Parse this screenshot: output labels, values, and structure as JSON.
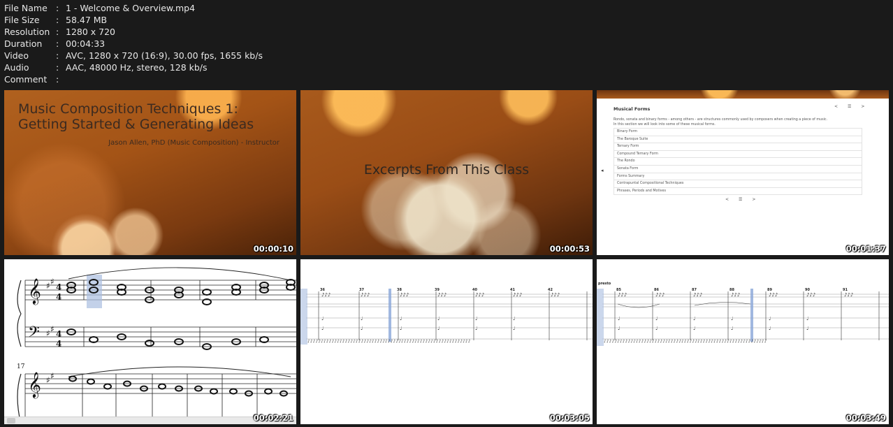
{
  "file_info": [
    {
      "label": "File Name",
      "value": "1 - Welcome & Overview.mp4"
    },
    {
      "label": "File Size",
      "value": "58.47 MB"
    },
    {
      "label": "Resolution",
      "value": "1280 x 720"
    },
    {
      "label": "Duration",
      "value": "00:04:33"
    },
    {
      "label": "Video",
      "value": "AVC, 1280 x 720 (16:9), 30.00 fps, 1655 kb/s"
    },
    {
      "label": "Audio",
      "value": "AAC, 48000 Hz, stereo, 128 kb/s"
    },
    {
      "label": "Comment",
      "value": ""
    }
  ],
  "thumbnails": [
    {
      "timestamp": "00:00:10",
      "title": "Music Composition Techniques 1:\nGetting Started & Generating Ideas",
      "subtitle": "Jason Allen, PhD (Music Composition) - Instructor"
    },
    {
      "timestamp": "00:00:53",
      "caption": "Excerpts From This Class"
    },
    {
      "timestamp": "00:01:37",
      "page_title": "Musical Forms",
      "nav": [
        "<",
        "☰",
        ">"
      ],
      "intro": "Rondo, sonata and binary forms - among others - are structures commonly used by composers when creating a piece of music.",
      "intro2": "In this section we will look into some of these musical forms.",
      "items": [
        "Binary Form",
        "The Baroque Suite",
        "Ternary Form",
        "Compound Ternary Form",
        "The Rondo",
        "Sonata Form",
        "Forms Summary",
        "Contrapuntal Compositional Techniques",
        "Phrases, Periods and Motives"
      ]
    },
    {
      "timestamp": "00:02:21",
      "measure_number": "17"
    },
    {
      "timestamp": "00:03:05",
      "measures": [
        "36",
        "37",
        "38",
        "39",
        "40",
        "41",
        "42"
      ]
    },
    {
      "timestamp": "00:03:49",
      "tempo_mark": "presto",
      "measures": [
        "85",
        "86",
        "87",
        "88",
        "89",
        "90",
        "91"
      ]
    }
  ]
}
